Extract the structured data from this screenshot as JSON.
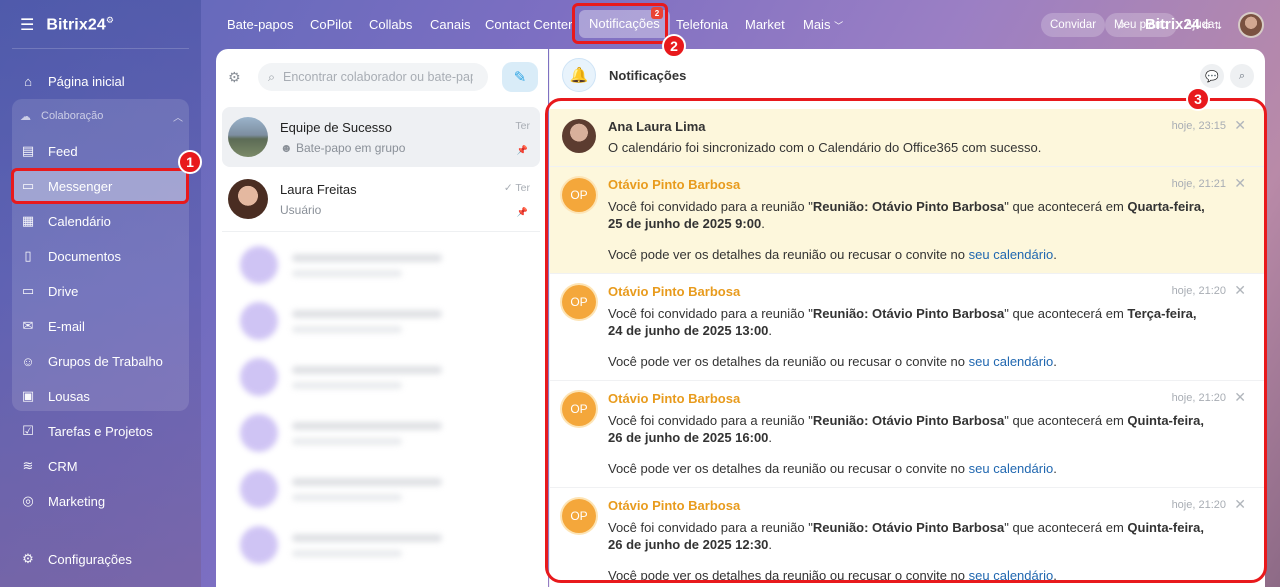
{
  "app": {
    "name": "Bitrix24"
  },
  "sidebar": {
    "items": [
      {
        "label": "Página inicial",
        "icon": "home-icon"
      },
      {
        "label": "Colaboração",
        "icon": "collab-icon"
      },
      {
        "label": "Feed",
        "icon": "feed-icon"
      },
      {
        "label": "Messenger",
        "icon": "chat-icon"
      },
      {
        "label": "Calendário",
        "icon": "calendar-icon"
      },
      {
        "label": "Documentos",
        "icon": "document-icon"
      },
      {
        "label": "Drive",
        "icon": "drive-icon"
      },
      {
        "label": "E-mail",
        "icon": "mail-icon"
      },
      {
        "label": "Grupos de Trabalho",
        "icon": "groups-icon"
      },
      {
        "label": "Lousas",
        "icon": "board-icon"
      },
      {
        "label": "Tarefas e Projetos",
        "icon": "tasks-icon"
      },
      {
        "label": "CRM",
        "icon": "crm-icon"
      },
      {
        "label": "Marketing",
        "icon": "marketing-icon"
      },
      {
        "label": "Configurações",
        "icon": "gear-icon"
      }
    ]
  },
  "topnav": {
    "tabs": [
      "Bate-papos",
      "CoPilot",
      "Collabs",
      "Canais",
      "Contact Center",
      "Notificações",
      "Telefonia",
      "Market",
      "Mais"
    ],
    "notif_count": "2",
    "brand": "Bitrix24",
    "invite": "Convidar",
    "plan": "Meu plano",
    "help": "Ajuda"
  },
  "callouts": [
    "1",
    "2",
    "3"
  ],
  "chatlist": {
    "search_placeholder": "Encontrar colaborador ou bate-papo",
    "chats": [
      {
        "name": "Equipe de Sucesso",
        "sub": "Bate-papo em grupo",
        "meta": "Ter"
      },
      {
        "name": "Laura Freitas",
        "sub": "Usuário",
        "meta": "Ter"
      }
    ]
  },
  "notifications": {
    "title": "Notificações",
    "items": [
      {
        "author": "Ana Laura Lima",
        "time": "hoje, 23:15",
        "text": "O calendário foi sincronizado com o Calendário do Office365 com sucesso."
      },
      {
        "author": "Otávio Pinto Barbosa",
        "initials": "OP",
        "time": "hoje, 21:21",
        "prefix": "Você foi convidado para a reunião \"",
        "meeting": "Reunião: Otávio Pinto Barbosa",
        "middle": "\" que acontecerá em ",
        "date": "Quarta-feira, 25 de junho de 2025 9:00",
        "suffix": ".",
        "details_prefix": "Você pode ver os detalhes da reunião ou recusar o convite no ",
        "link": "seu calendário",
        "details_suffix": "."
      },
      {
        "author": "Otávio Pinto Barbosa",
        "initials": "OP",
        "time": "hoje, 21:20",
        "prefix": "Você foi convidado para a reunião \"",
        "meeting": "Reunião: Otávio Pinto Barbosa",
        "middle": "\" que acontecerá em ",
        "date": "Terça-feira, 24 de junho de 2025 13:00",
        "suffix": ".",
        "details_prefix": "Você pode ver os detalhes da reunião ou recusar o convite no ",
        "link": "seu calendário",
        "details_suffix": "."
      },
      {
        "author": "Otávio Pinto Barbosa",
        "initials": "OP",
        "time": "hoje, 21:20",
        "prefix": "Você foi convidado para a reunião \"",
        "meeting": "Reunião: Otávio Pinto Barbosa",
        "middle": "\" que acontecerá em ",
        "date": "Quinta-feira, 26 de junho de 2025 16:00",
        "suffix": ".",
        "details_prefix": "Você pode ver os detalhes da reunião ou recusar o convite no ",
        "link": "seu calendário",
        "details_suffix": "."
      },
      {
        "author": "Otávio Pinto Barbosa",
        "initials": "OP",
        "time": "hoje, 21:20",
        "prefix": "Você foi convidado para a reunião \"",
        "meeting": "Reunião: Otávio Pinto Barbosa",
        "middle": "\" que acontecerá em ",
        "date": "Quinta-feira, 26 de junho de 2025 12:30",
        "suffix": ".",
        "details_prefix": "Você pode ver os detalhes da reunião ou recusar o convite no ",
        "link": "seu calendário",
        "details_suffix": "."
      }
    ]
  },
  "colors": {
    "highlight": "#e8191c",
    "accent": "#2fa5e4",
    "author_orange": "#e89b1d",
    "notif_bg": "#fdf7dc"
  }
}
